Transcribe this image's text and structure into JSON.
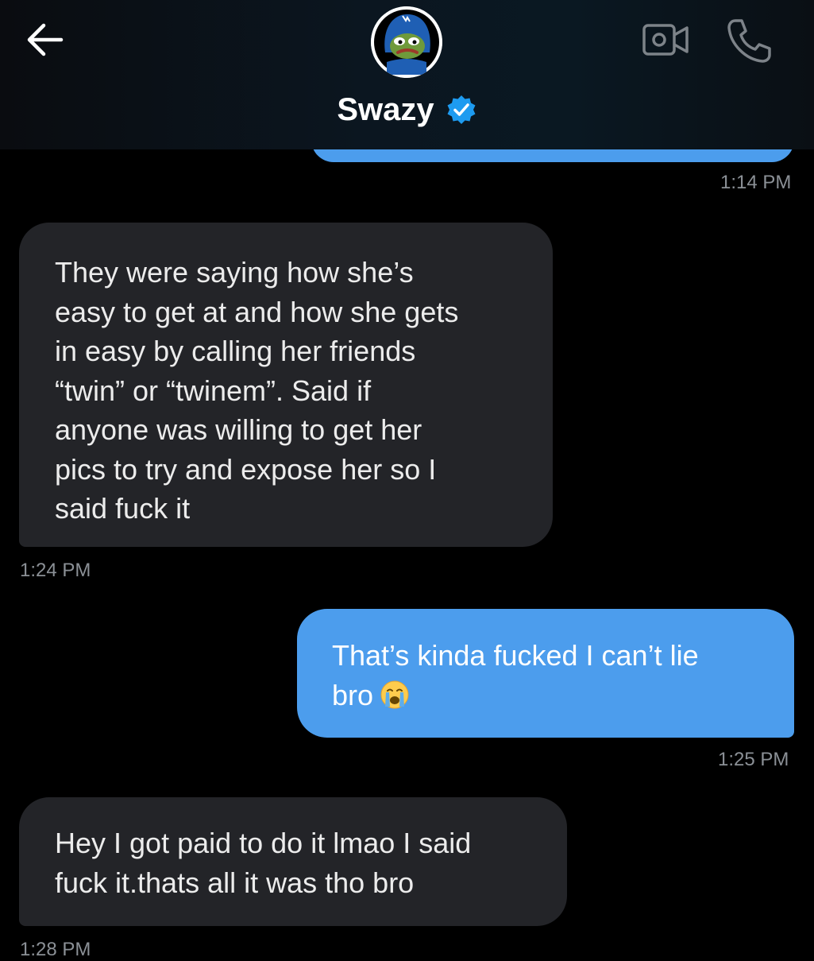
{
  "header": {
    "contact_name": "Swazy",
    "back_icon": "arrow-left-icon",
    "verified_icon": "verified-badge-icon",
    "video_icon": "video-camera-icon",
    "phone_icon": "phone-icon",
    "accent": "#4c9ded"
  },
  "messages": [
    {
      "direction": "outgoing",
      "text": "",
      "time": "1:14 PM"
    },
    {
      "direction": "incoming",
      "text": "They were saying how she’s\neasy to get at and how she gets\nin easy by calling her friends\n“twin” or “twinem”. Said if\nanyone was willing to get her\npics to try and expose her so I\nsaid fuck it",
      "time": "1:24 PM"
    },
    {
      "direction": "outgoing",
      "text": "That’s kinda fucked I can’t lie\nbro",
      "emoji": "crying-face-icon",
      "time": "1:25 PM"
    },
    {
      "direction": "incoming",
      "text": "Hey I got paid to do it lmao I said\nfuck it.thats all it was tho bro",
      "time": "1:28 PM"
    }
  ],
  "colors": {
    "background": "#000000",
    "incoming_bubble": "#232428",
    "outgoing_bubble": "#4c9ded",
    "timestamp": "#8b9096"
  }
}
